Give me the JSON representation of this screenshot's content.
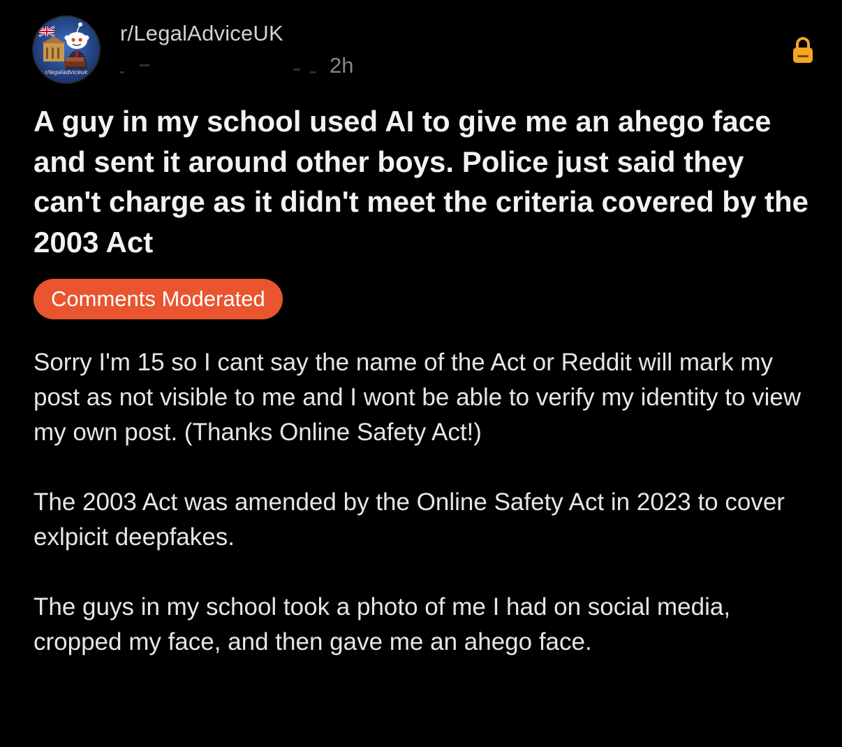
{
  "post": {
    "subreddit": "r/LegalAdviceUK",
    "avatar_caption": "r/legaladviceuk",
    "age": "2h",
    "title": "A guy in my school used AI to give me an ahego face and sent it around other boys. Police just said they can't charge as it didn't meet the criteria covered by the 2003 Act",
    "flair": "Comments Moderated",
    "body_paragraphs": [
      "Sorry I'm 15 so I cant say the name of the Act or Reddit will mark my post as not visible to me and I wont be able to verify my identity to view my own post. (Thanks Online Safety Act!)",
      "The 2003 Act was amended by the Online Safety Act in 2023 to cover exlpicit deepfakes.",
      "The guys in my school took a photo of me I had on social media, cropped my face, and then gave me an ahego face."
    ]
  },
  "icons": {
    "avatar": "subreddit-avatar",
    "lock": "lock-icon"
  },
  "colors": {
    "background": "#000000",
    "flair": "#e8552f",
    "lock": "#f5a623",
    "title": "#f2f2f2",
    "body": "#e6e6e6",
    "muted": "#8a8a8a"
  }
}
